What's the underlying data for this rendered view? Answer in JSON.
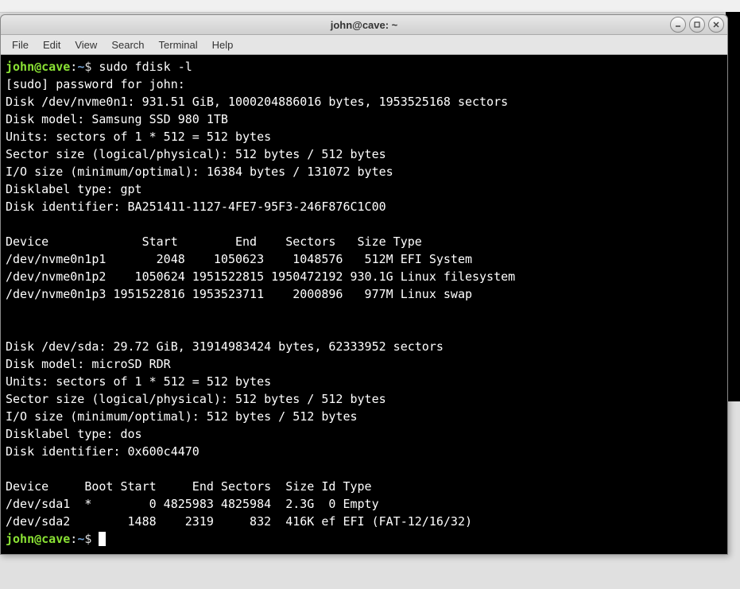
{
  "window": {
    "title": "john@cave: ~"
  },
  "menubar": {
    "file": "File",
    "edit": "Edit",
    "view": "View",
    "search": "Search",
    "terminal": "Terminal",
    "help": "Help"
  },
  "prompt": {
    "user": "john",
    "at": "@",
    "host": "cave",
    "colon": ":",
    "path": "~",
    "dollar": "$ "
  },
  "cmd1": "sudo fdisk -l",
  "out": {
    "sudo_prompt": "[sudo] password for john:",
    "d1_line1": "Disk /dev/nvme0n1: 931.51 GiB, 1000204886016 bytes, 1953525168 sectors",
    "d1_line2": "Disk model: Samsung SSD 980 1TB",
    "d1_line3": "Units: sectors of 1 * 512 = 512 bytes",
    "d1_line4": "Sector size (logical/physical): 512 bytes / 512 bytes",
    "d1_line5": "I/O size (minimum/optimal): 16384 bytes / 131072 bytes",
    "d1_line6": "Disklabel type: gpt",
    "d1_line7": "Disk identifier: BA251411-1127-4FE7-95F3-246F876C1C00",
    "d1_hdr": "Device             Start        End    Sectors   Size Type",
    "d1_p1": "/dev/nvme0n1p1       2048    1050623    1048576   512M EFI System",
    "d1_p2": "/dev/nvme0n1p2    1050624 1951522815 1950472192 930.1G Linux filesystem",
    "d1_p3": "/dev/nvme0n1p3 1951522816 1953523711    2000896   977M Linux swap",
    "d2_line1": "Disk /dev/sda: 29.72 GiB, 31914983424 bytes, 62333952 sectors",
    "d2_line2": "Disk model: microSD RDR",
    "d2_line3": "Units: sectors of 1 * 512 = 512 bytes",
    "d2_line4": "Sector size (logical/physical): 512 bytes / 512 bytes",
    "d2_line5": "I/O size (minimum/optimal): 512 bytes / 512 bytes",
    "d2_line6": "Disklabel type: dos",
    "d2_line7": "Disk identifier: 0x600c4470",
    "d2_hdr": "Device     Boot Start     End Sectors  Size Id Type",
    "d2_p1": "/dev/sda1  *        0 4825983 4825984  2.3G  0 Empty",
    "d2_p2": "/dev/sda2        1488    2319     832  416K ef EFI (FAT-12/16/32)"
  }
}
